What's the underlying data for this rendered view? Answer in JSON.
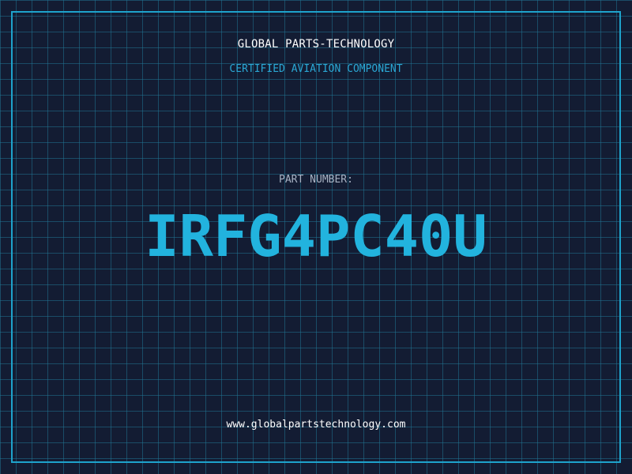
{
  "header": {
    "company": "GLOBAL PARTS-TECHNOLOGY",
    "subtitle": "CERTIFIED AVIATION COMPONENT"
  },
  "part": {
    "label": "PART NUMBER:",
    "number": "IRFG4PC40U"
  },
  "footer": {
    "website": "www.globalpartstechnology.com"
  },
  "colors": {
    "background": "#131c33",
    "grid": "#207391",
    "accent": "#1ea3cc",
    "part_number": "#22b3de"
  }
}
